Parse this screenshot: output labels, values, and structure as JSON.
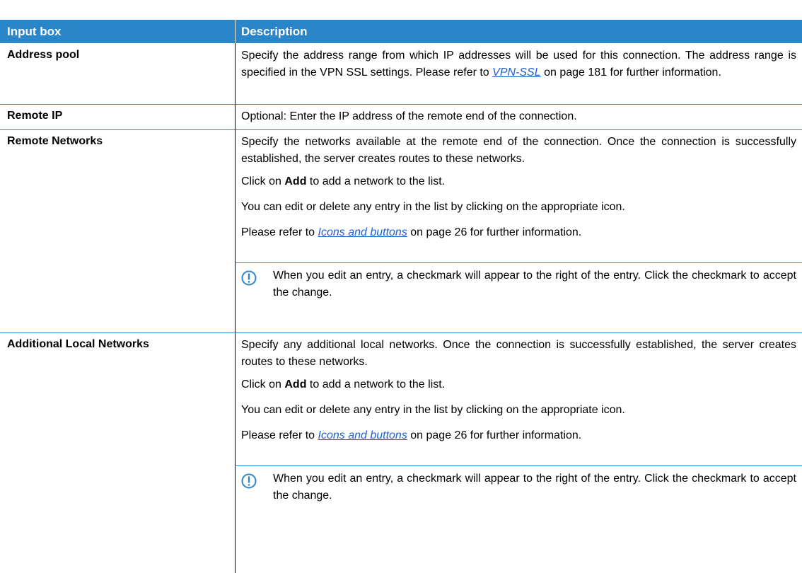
{
  "header": {
    "col1": "Input box",
    "col2": "Description"
  },
  "rows": {
    "address_pool": {
      "label": "Address pool",
      "p1_pre": "Specify the address range from which IP addresses will be used for this connection. The address range is specified in the VPN SSL settings. Please refer to ",
      "p1_link": "VPN-SSL",
      "p1_post": " on page 181 for further information."
    },
    "remote_ip": {
      "label": "Remote IP",
      "p1": "Optional: Enter the IP address of the remote end of the connection."
    },
    "remote_networks": {
      "label": "Remote Networks",
      "p1": "Specify the networks available at the remote end of the connection. Once the connection is successfully established, the server creates routes to these networks.",
      "p2_pre": "Click on ",
      "p2_bold": "Add",
      "p2_post": " to add a network to the list.",
      "p3": "You can edit or delete any entry in the list by clicking on the appropriate icon.",
      "p4_pre": "Please refer to ",
      "p4_link": "Icons and buttons",
      "p4_post": " on page 26 for further information.",
      "note": "When you edit an entry, a checkmark will appear to the right of the entry. Click the checkmark to accept the change."
    },
    "additional_local_networks": {
      "label": "Additional Local Networks",
      "p1": "Specify any additional local networks. Once the connection is successfully established, the server creates routes to these networks.",
      "p2_pre": "Click on ",
      "p2_bold": "Add",
      "p2_post": " to add a network to the list.",
      "p3": "You can edit or delete any entry in the list by clicking on the appropriate icon.",
      "p4_pre": "Please refer to ",
      "p4_link": "Icons and buttons",
      "p4_post": " on page 26 for further information.",
      "note": "When you edit an entry, a checkmark will appear to the right of the entry. Click the checkmark to accept the change."
    }
  },
  "icons": {
    "note": "info-exclamation-icon"
  },
  "colors": {
    "header_bg": "#2a86c8",
    "link": "#1f5fd1",
    "rule": "#2a86c8"
  }
}
